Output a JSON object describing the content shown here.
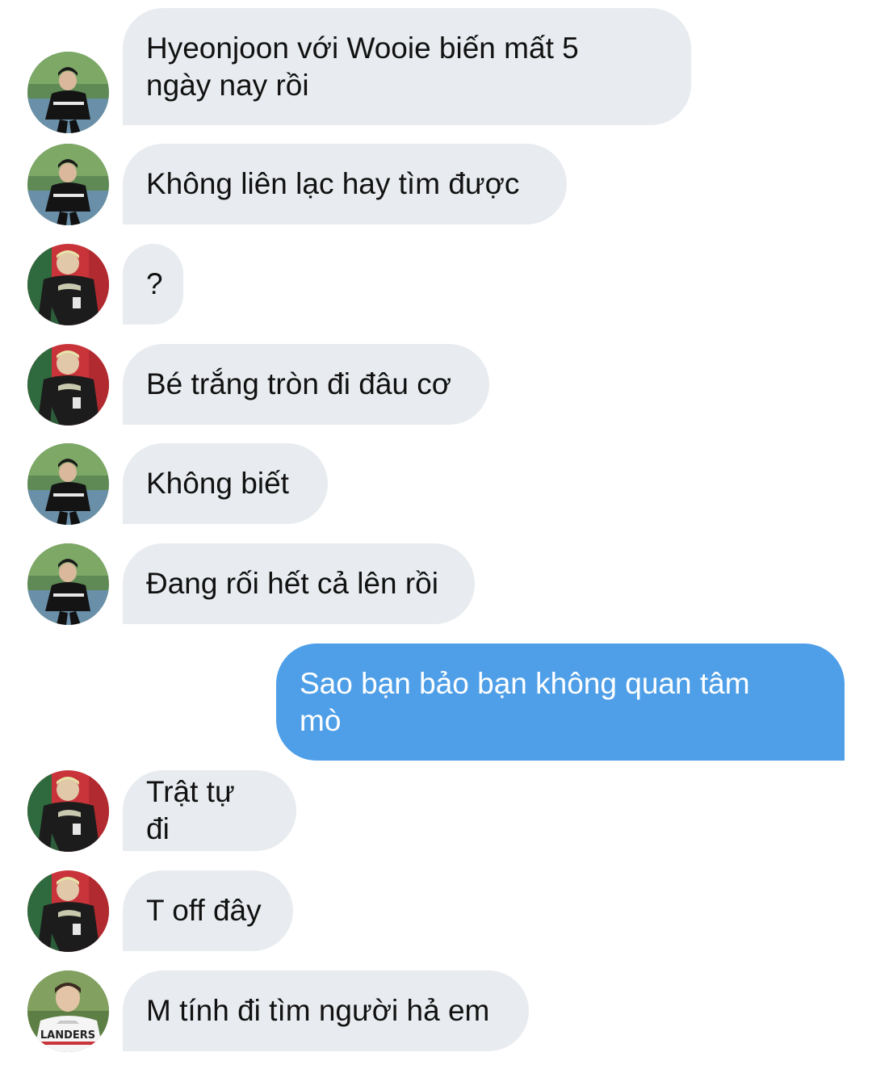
{
  "messages": [
    {
      "text": "Hyeonjoon với Wooie biến mất 5\nngày nay rồi",
      "sender": "incoming",
      "avatar": "avatar-a"
    },
    {
      "text": "Không liên lạc hay tìm được",
      "sender": "incoming",
      "avatar": "avatar-a"
    },
    {
      "text": "?",
      "sender": "incoming",
      "avatar": "avatar-b"
    },
    {
      "text": "Bé trắng tròn đi đâu cơ",
      "sender": "incoming",
      "avatar": "avatar-b"
    },
    {
      "text": "Không biết",
      "sender": "incoming",
      "avatar": "avatar-a"
    },
    {
      "text": "Đang rối hết cả lên rồi",
      "sender": "incoming",
      "avatar": "avatar-a"
    },
    {
      "text": "Sao bạn bảo bạn không quan tâm\nmò",
      "sender": "outgoing"
    },
    {
      "text": "Trật tự đi",
      "sender": "incoming",
      "avatar": "avatar-b"
    },
    {
      "text": "T off đây",
      "sender": "incoming",
      "avatar": "avatar-b"
    },
    {
      "text": "M tính đi tìm người hả em",
      "sender": "incoming",
      "avatar": "avatar-c"
    }
  ],
  "colors": {
    "incoming_bubble": "#e8ebef",
    "outgoing_bubble": "#4f9fe8",
    "incoming_text": "#111111",
    "outgoing_text": "#ffffff"
  }
}
